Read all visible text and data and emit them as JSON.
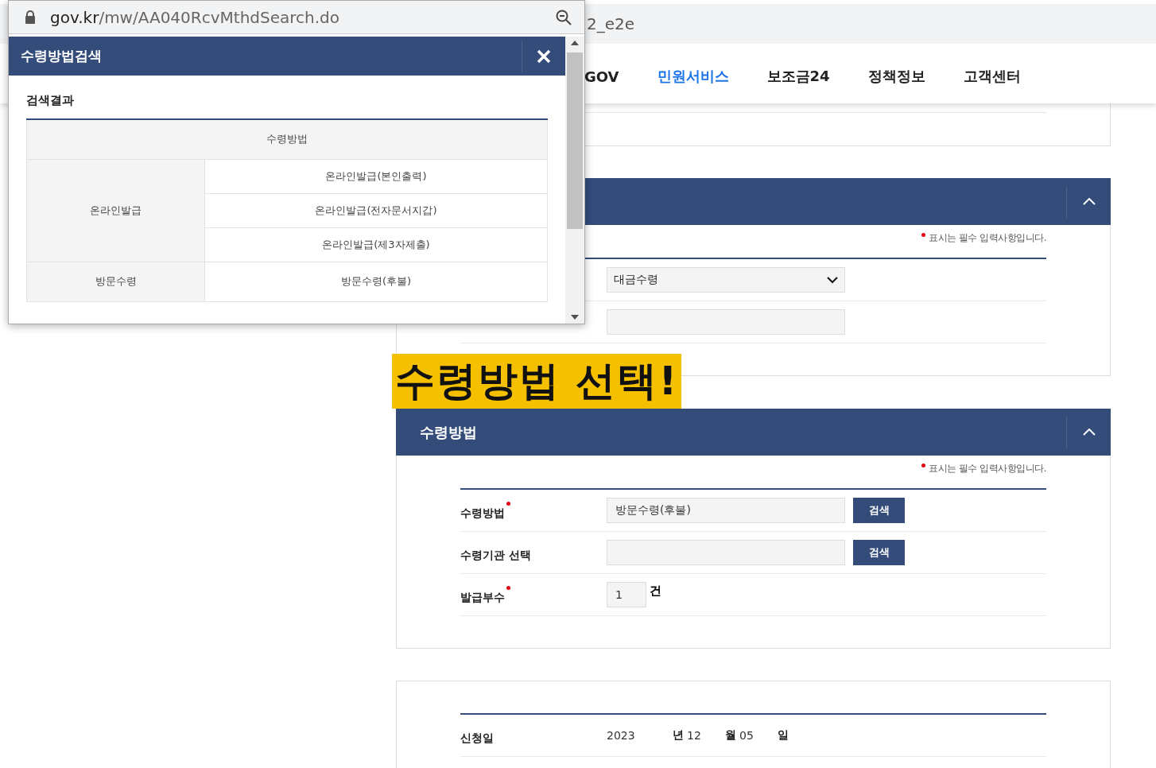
{
  "browser": {
    "url_tail": "2_e2e"
  },
  "nav": {
    "items": [
      {
        "label": "GOV",
        "selected": false
      },
      {
        "label": "민원서비스",
        "selected": true
      },
      {
        "label": "보조금24",
        "selected": false
      },
      {
        "label": "정책정보",
        "selected": false
      },
      {
        "label": "고객센터",
        "selected": false
      }
    ]
  },
  "sections": [
    {
      "expanded": true,
      "required_note": "표시는 필수 입력사항입니다.",
      "rows": [
        {
          "kind": "select",
          "value": "대금수령"
        },
        {
          "kind": "input",
          "value": ""
        }
      ]
    },
    {
      "title": "수령방법",
      "expanded": true,
      "required_note": "표시는 필수 입력사항입니다.",
      "rows": [
        {
          "kind": "input",
          "label": "수령방법",
          "value": "방문수령(후불)",
          "required": true,
          "button": "검색"
        },
        {
          "kind": "input",
          "label": "수령기관 선택",
          "value": "",
          "required": false,
          "button": "검색"
        },
        {
          "kind": "count",
          "label": "발급부수",
          "value": "1",
          "unit": "건",
          "required": true
        }
      ]
    }
  ],
  "date_row": {
    "label": "신청일",
    "parts": [
      {
        "value": "2023",
        "unit": "년"
      },
      {
        "value": "12",
        "unit": "월"
      },
      {
        "value": "05",
        "unit": "일"
      }
    ]
  },
  "callout": "수령방법 선택!",
  "popup": {
    "url_host": "gov.kr",
    "url_path": "/mw/AA040RcvMthdSearch.do",
    "title": "수령방법검색",
    "results_title": "검색결과",
    "column": "수령방법",
    "groups": [
      {
        "name": "온라인발급",
        "items": [
          "온라인발급(본인출력)",
          "온라인발급(전자문서지갑)",
          "온라인발급(제3자제출)"
        ]
      },
      {
        "name": "방문수령",
        "items": [
          "방문수령(후불)"
        ]
      }
    ]
  }
}
